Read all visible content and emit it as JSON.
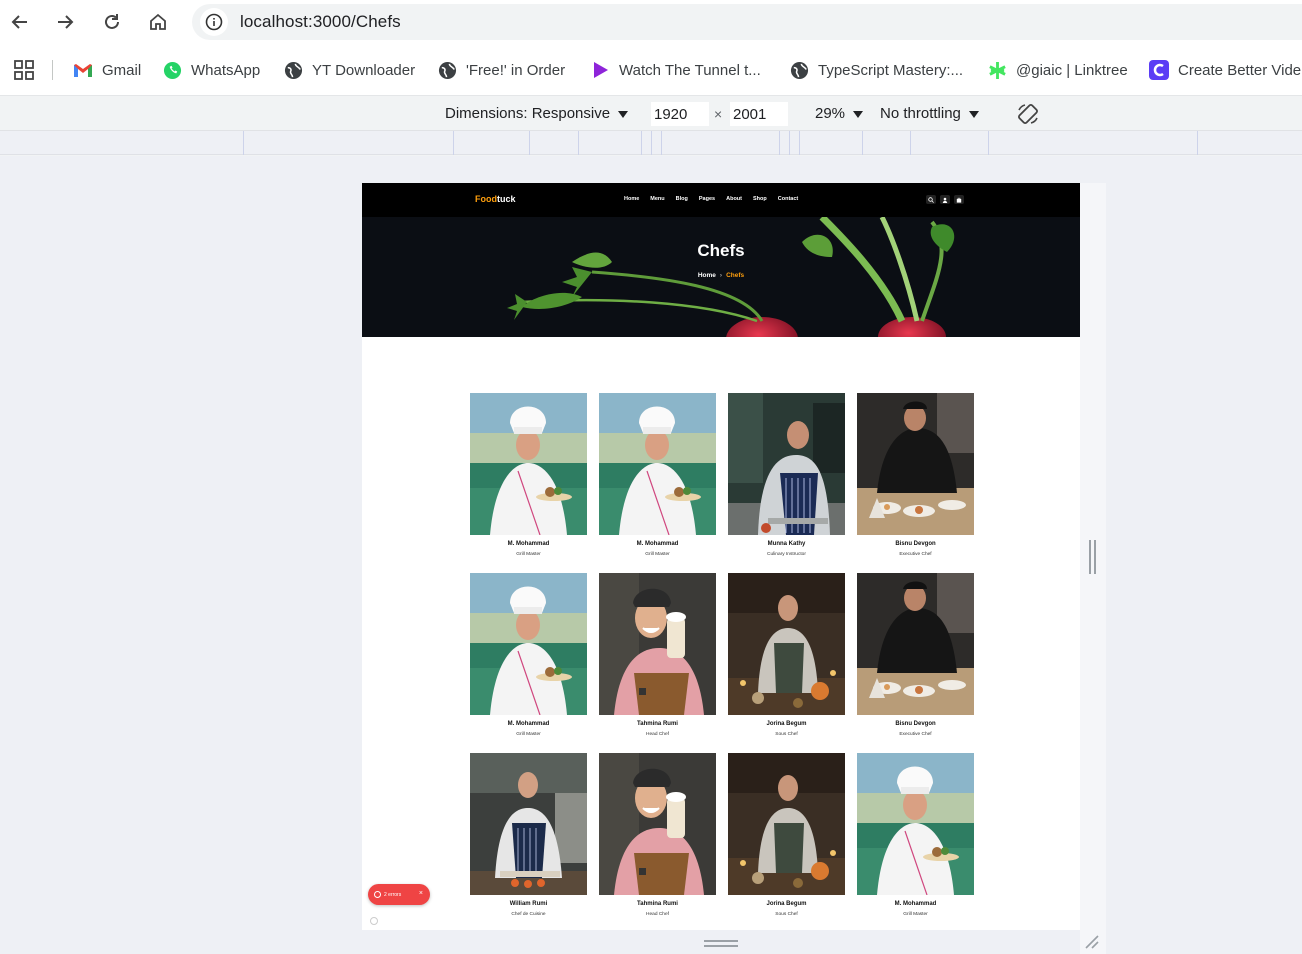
{
  "browser": {
    "url": "localhost:3000/Chefs"
  },
  "bookmarks": [
    {
      "label": "Gmail",
      "icon": "gmail-icon"
    },
    {
      "label": "WhatsApp",
      "icon": "whatsapp-icon"
    },
    {
      "label": "YT Downloader",
      "icon": "globe-icon"
    },
    {
      "label": "'Free!' in Order",
      "icon": "globe-icon"
    },
    {
      "label": "Watch The Tunnel t...",
      "icon": "play-icon"
    },
    {
      "label": "TypeScript Mastery:...",
      "icon": "globe-icon"
    },
    {
      "label": "@giaic | Linktree",
      "icon": "linktree-icon"
    },
    {
      "label": "Create Better Vide",
      "icon": "app-icon"
    }
  ],
  "devtools": {
    "dimensions_label": "Dimensions: Responsive",
    "width": "1920",
    "height": "2001",
    "times": "×",
    "zoom": "29%",
    "throttling": "No throttling"
  },
  "site": {
    "logo_part1": "Food",
    "logo_part2": "tuck",
    "menu": [
      "Home",
      "Menu",
      "Blog",
      "Pages",
      "About",
      "Shop",
      "Contact"
    ],
    "hero_title": "Chefs",
    "breadcrumb_home": "Home",
    "breadcrumb_sep": "›",
    "breadcrumb_current": "Chefs",
    "accent_color": "#ff9f0d",
    "chefs": [
      {
        "name": "M. Mohammad",
        "role": "Grill Master",
        "photo": "white-uniform-chef"
      },
      {
        "name": "M. Mohammad",
        "role": "Grill Master",
        "photo": "white-uniform-chef"
      },
      {
        "name": "Munna Kathy",
        "role": "Culinary Instructor",
        "photo": "striped-apron-chef"
      },
      {
        "name": "Bisnu Devgon",
        "role": "Executive Chef",
        "photo": "plating-chef"
      },
      {
        "name": "M. Mohammad",
        "role": "Grill Master",
        "photo": "white-uniform-chef"
      },
      {
        "name": "Tahmina Rumi",
        "role": "Head Chef",
        "photo": "milkshake-chef"
      },
      {
        "name": "Jorina Begum",
        "role": "Sous Chef",
        "photo": "kitchen-chef"
      },
      {
        "name": "Bisnu Devgon",
        "role": "Executive Chef",
        "photo": "plating-chef"
      },
      {
        "name": "William Rumi",
        "role": "Chef de Cuisine",
        "photo": "cutting-chef"
      },
      {
        "name": "Tahmina Rumi",
        "role": "Head Chef",
        "photo": "milkshake-chef"
      },
      {
        "name": "Jorina Begum",
        "role": "Sous Chef",
        "photo": "kitchen-chef"
      },
      {
        "name": "M. Mohammad",
        "role": "Grill Master",
        "photo": "white-uniform-chef"
      }
    ],
    "error_badge": "2 errors",
    "error_close": "×"
  }
}
